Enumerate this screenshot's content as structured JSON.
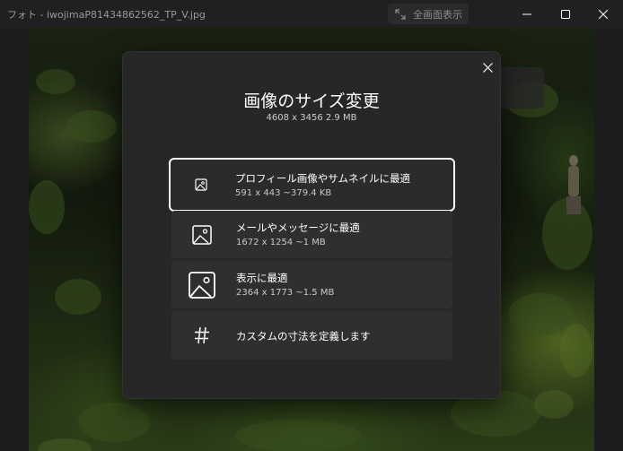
{
  "window": {
    "title": "フォト - iwojimaP81434862562_TP_V.jpg",
    "fullscreen_label": "全画面表示"
  },
  "dialog": {
    "title": "画像のサイズ変更",
    "subtitle": "4608 x 3456    2.9 MB",
    "options": [
      {
        "label": "プロフィール画像やサムネイルに最適",
        "dims": "591 x 443    ~379.4 KB",
        "icon": "image-small-icon",
        "selected": true
      },
      {
        "label": "メールやメッセージに最適",
        "dims": "1672 x 1254    ~1 MB",
        "icon": "image-medium-icon",
        "selected": false
      },
      {
        "label": "表示に最適",
        "dims": "2364 x 1773    ~1.5 MB",
        "icon": "image-large-icon",
        "selected": false
      },
      {
        "label": "カスタムの寸法を定義します",
        "icon": "hash-icon",
        "selected": false
      }
    ]
  }
}
